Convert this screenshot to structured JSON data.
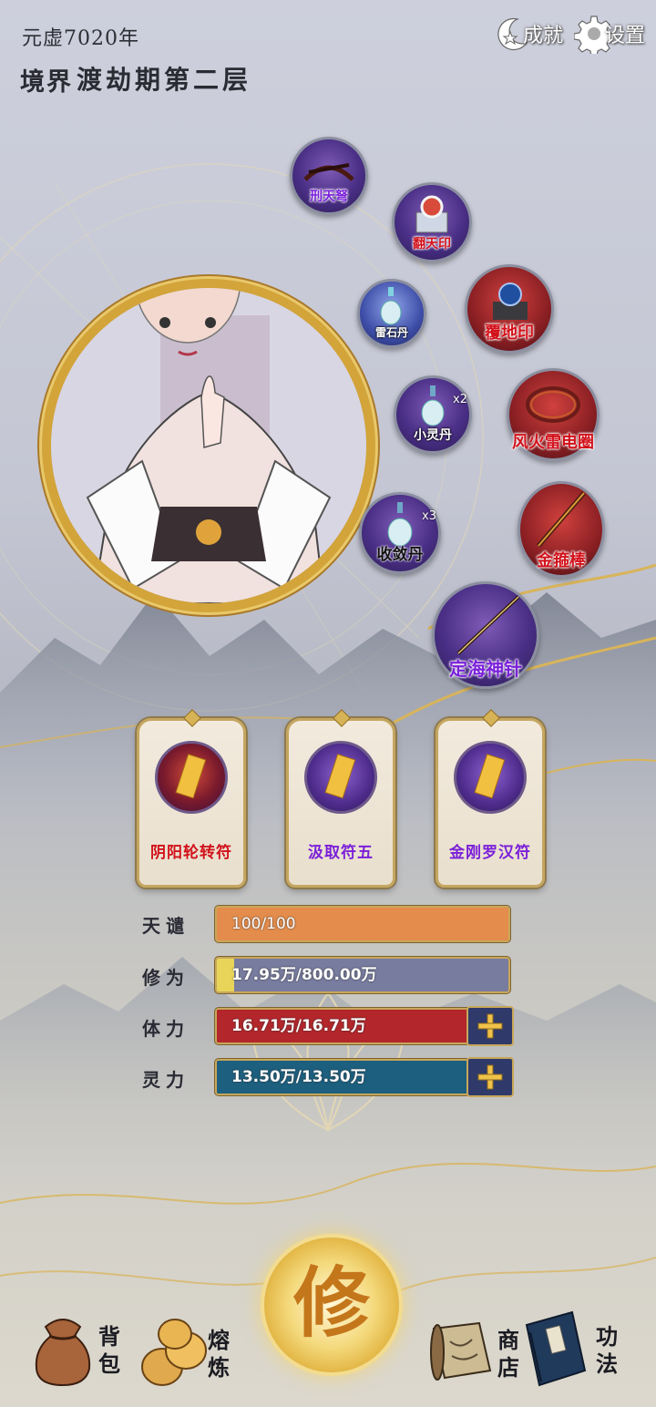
{
  "header": {
    "era": "元虚7020年",
    "realm_label": "境界",
    "realm_value": "渡劫期第二层",
    "achievements_label": "成就",
    "settings_label": "设置"
  },
  "treasures": [
    {
      "name": "刑天弩",
      "icon": "crossbow-icon"
    },
    {
      "name": "翻天印",
      "icon": "seal-icon"
    },
    {
      "name": "雷石丹",
      "icon": "pill-bottle-icon"
    },
    {
      "name": "覆地印",
      "icon": "orb-seal-icon"
    },
    {
      "name": "小灵丹",
      "icon": "pill-bottle-icon",
      "count": "x2"
    },
    {
      "name": "风火雷电圈",
      "icon": "ring-icon"
    },
    {
      "name": "收敛丹",
      "icon": "pill-bottle-icon",
      "count": "x3"
    },
    {
      "name": "金箍棒",
      "icon": "staff-icon"
    },
    {
      "name": "定海神针",
      "icon": "needle-icon"
    }
  ],
  "talismans": [
    {
      "name": "阴阳轮转符",
      "color": "#d2121b"
    },
    {
      "name": "汲取符五",
      "color": "#7a1fd9"
    },
    {
      "name": "金刚罗汉符",
      "color": "#7a1fd9"
    }
  ],
  "stats": [
    {
      "label": "天谴",
      "value": "100/100",
      "fraction": 1.0,
      "color": "#e38c4c"
    },
    {
      "label": "修为",
      "value": "17.95万/800.00万",
      "fraction": 0.0224,
      "color": "#787c9f"
    },
    {
      "label": "体力",
      "value": "16.71万/16.71万",
      "fraction": 1.0,
      "color": "#b3262b"
    },
    {
      "label": "灵力",
      "value": "13.50万/13.50万",
      "fraction": 1.0,
      "color": "#1d5f7e"
    }
  ],
  "nav": {
    "bag": "背包",
    "smelt": "熔炼",
    "cultivate": "修",
    "shop": "商店",
    "skills": "功法"
  }
}
